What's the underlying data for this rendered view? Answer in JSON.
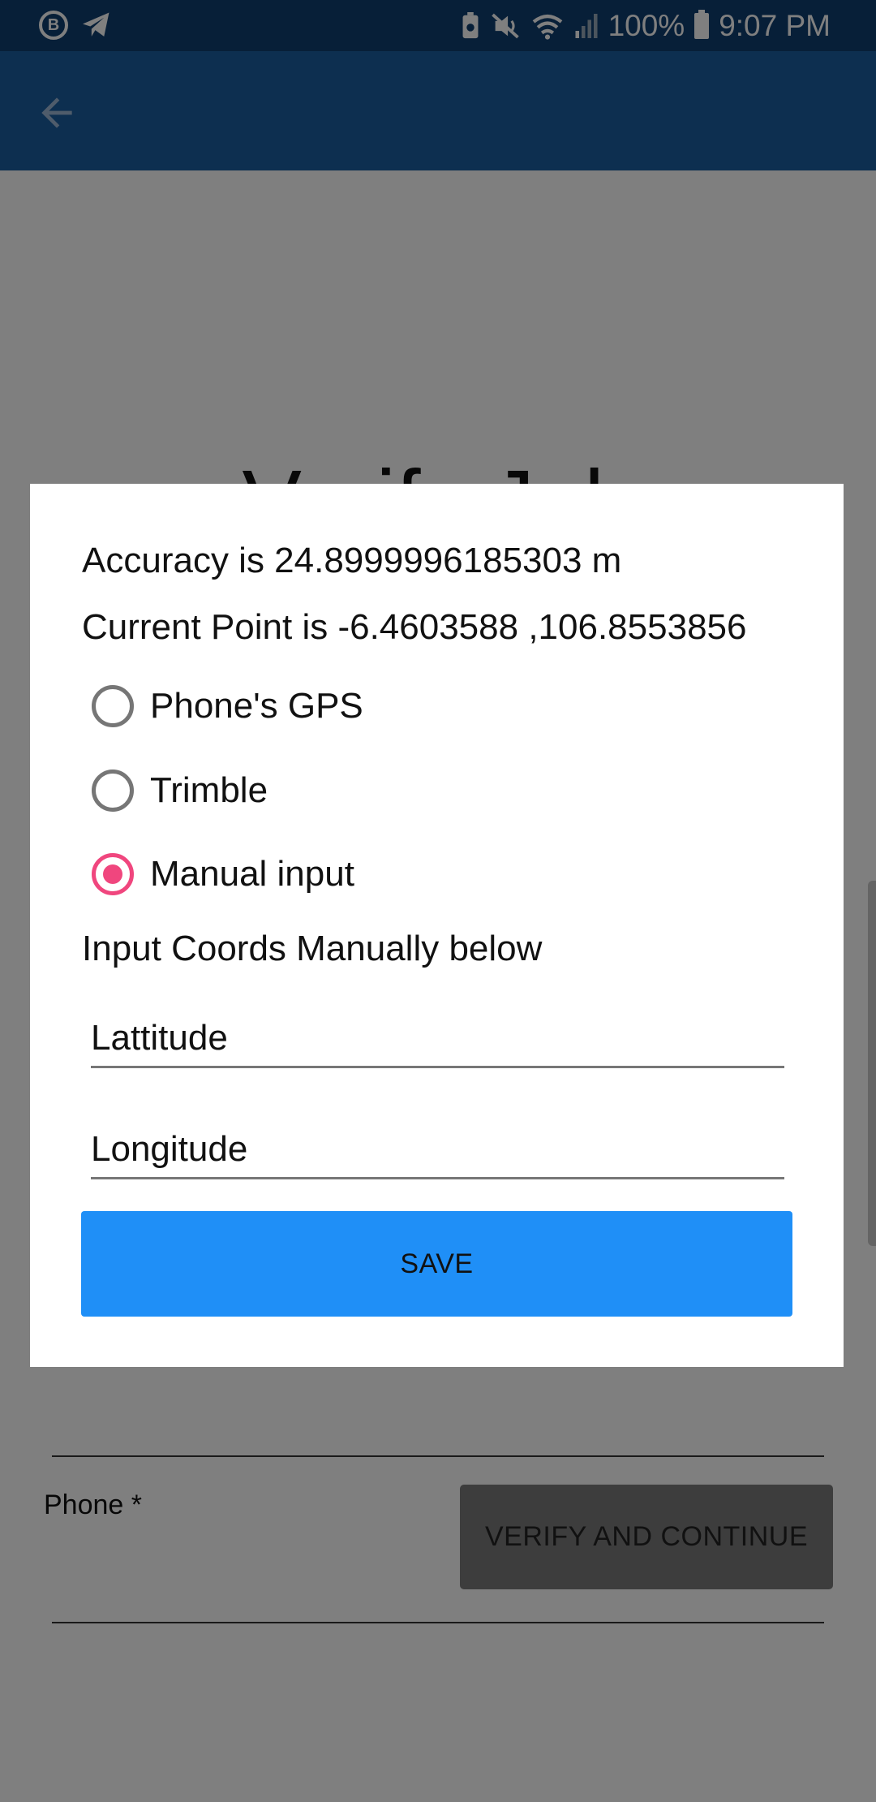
{
  "status_bar": {
    "left_icons": [
      "b-circle-icon",
      "telegram-icon"
    ],
    "battery_percent": "100%",
    "time": "9:07 PM",
    "icons": [
      "battery-saver-icon",
      "mute-icon",
      "wifi-icon",
      "signal-icon",
      "battery-icon"
    ]
  },
  "app_bar": {
    "back_icon": "arrow-back-icon",
    "color": "#1b5fa0"
  },
  "background_page": {
    "title": "Verify Job",
    "phone_label": "Phone *",
    "verify_button_label": "VERIFY AND CONTINUE"
  },
  "dialog": {
    "accuracy_text": "Accuracy is 24.8999996185303 m",
    "current_point_text": "Current Point is -6.4603588 ,106.8553856",
    "radio_options": [
      {
        "label": "Phone's GPS",
        "checked": false
      },
      {
        "label": "Trimble",
        "checked": false
      },
      {
        "label": "Manual input",
        "checked": true
      }
    ],
    "instruction": "Input Coords Manually below",
    "latitude_placeholder": "Lattitude",
    "longitude_placeholder": "Longitude",
    "save_label": "SAVE"
  },
  "colors": {
    "status_bar": "#0f3f70",
    "save_button": "#1f8ff7",
    "radio_checked": "#f0467e"
  }
}
